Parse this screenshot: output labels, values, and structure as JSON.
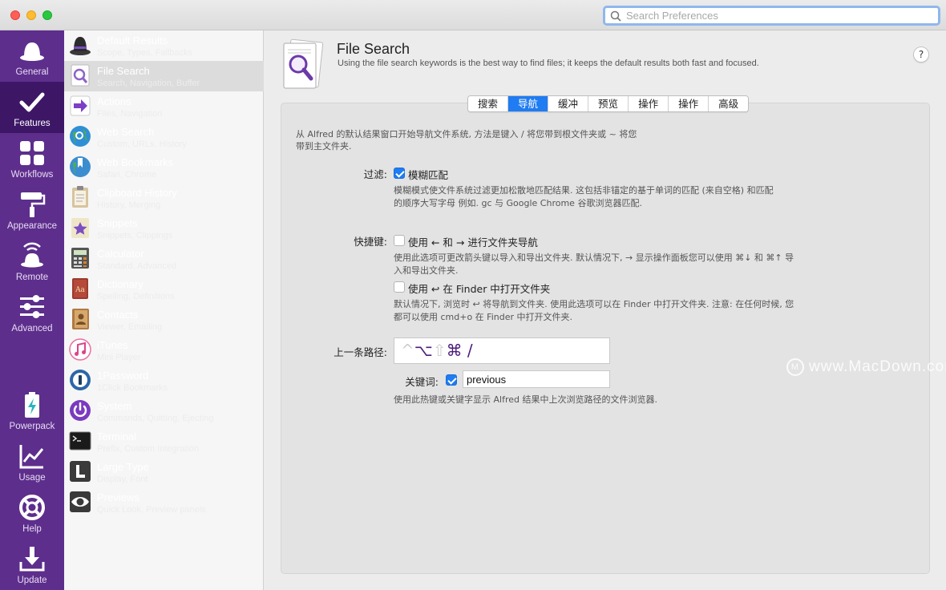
{
  "search": {
    "placeholder": "Search Preferences"
  },
  "nav": [
    {
      "label": "General",
      "icon": "hat-icon"
    },
    {
      "label": "Features",
      "icon": "checkmark-icon"
    },
    {
      "label": "Workflows",
      "icon": "grid-icon"
    },
    {
      "label": "Appearance",
      "icon": "paint-roller-icon"
    },
    {
      "label": "Remote",
      "icon": "remote-icon"
    },
    {
      "label": "Advanced",
      "icon": "sliders-icon"
    },
    {
      "label": "Powerpack",
      "icon": "battery-icon"
    },
    {
      "label": "Usage",
      "icon": "chart-icon"
    },
    {
      "label": "Help",
      "icon": "lifebuoy-icon"
    },
    {
      "label": "Update",
      "icon": "download-icon"
    }
  ],
  "features": [
    {
      "title": "Default Results",
      "subtitle": "Scope, Types, Fallbacks",
      "color": "#3a3a3a"
    },
    {
      "title": "File Search",
      "subtitle": "Search, Navigation, Buffer",
      "color": "#8e63c9"
    },
    {
      "title": "Actions",
      "subtitle": "Files, Navigation",
      "color": "#7c3fc6"
    },
    {
      "title": "Web Search",
      "subtitle": "Custom, URLs, History",
      "color": "#2f8fd6"
    },
    {
      "title": "Web Bookmarks",
      "subtitle": "Safari, Chrome",
      "color": "#3c8dd0"
    },
    {
      "title": "Clipboard History",
      "subtitle": "History, Merging",
      "color": "#c7b28a"
    },
    {
      "title": "Snippets",
      "subtitle": "Snippets, Clippings",
      "color": "#7b4fc2"
    },
    {
      "title": "Calculator",
      "subtitle": "Standard, Advanced",
      "color": "#d9822b"
    },
    {
      "title": "Dictionary",
      "subtitle": "Spelling, Definitions",
      "color": "#9b3b2e"
    },
    {
      "title": "Contacts",
      "subtitle": "Viewer, Emailing",
      "color": "#b07a42"
    },
    {
      "title": "iTunes",
      "subtitle": "Mini Player",
      "color": "#e86fa1"
    },
    {
      "title": "1Password",
      "subtitle": "1Click Bookmarks",
      "color": "#2c67a8"
    },
    {
      "title": "System",
      "subtitle": "Commands, Quitting, Ejecting",
      "color": "#7a3bbf"
    },
    {
      "title": "Terminal",
      "subtitle": "Prefix, Custom Integration",
      "color": "#1a1a1a"
    },
    {
      "title": "Large Type",
      "subtitle": "Display, Font",
      "color": "#3a3a3a"
    },
    {
      "title": "Previews",
      "subtitle": "Quick Look, Preview panels",
      "color": "#3a3a3a"
    }
  ],
  "header": {
    "title": "File Search",
    "description": "Using the file search keywords is the best way to find files; it keeps the default results both fast and focused.",
    "help": "?"
  },
  "tabs": [
    "搜索",
    "导航",
    "缓冲",
    "预览",
    "操作",
    "操作",
    "高级"
  ],
  "panel": {
    "intro": "从 Alfred 的默认结果窗口开始导航文件系统, 方法是键入 / 将您带到根文件夹或 ~ 将您带到主文件夹.",
    "filter_label": "过滤:",
    "fuzzy_label": "模糊匹配",
    "fuzzy_help": "模糊模式使文件系统过滤更加松散地匹配结果. 这包括非锚定的基于单词的匹配 (来自空格) 和匹配的顺序大写字母 例如. gc 与 Google Chrome 谷歌浏览器匹配.",
    "shortcut_label": "快捷键:",
    "arrow_label": "使用 ← 和 → 进行文件夹导航",
    "arrow_help": "使用此选项可更改箭头键以导入和导出文件夹. 默认情况下, → 显示操作面板您可以使用 ⌘↓ 和 ⌘↑ 导入和导出文件夹.",
    "finder_label": "使用 ↩ 在 Finder 中打开文件夹",
    "finder_help": "默认情况下, 浏览时 ↩ 将导航到文件夹. 使用此选项可以在 Finder 中打开文件夹. 注意: 在任何时候, 您都可以使用 cmd+o 在 Finder 中打开文件夹.",
    "prev_path_label": "上一条路径:",
    "hotkey_dim1": "^",
    "hotkey_main": "⌥",
    "hotkey_dim2": "⇧",
    "hotkey_main2": "⌘ /",
    "keyword_label": "关键词:",
    "keyword_value": "previous",
    "prev_help": "使用此热键或关键字显示 Alfred 结果中上次浏览路径的文件浏览器."
  },
  "watermark": {
    "text": "www.MacDown.com",
    "logo": "M"
  }
}
